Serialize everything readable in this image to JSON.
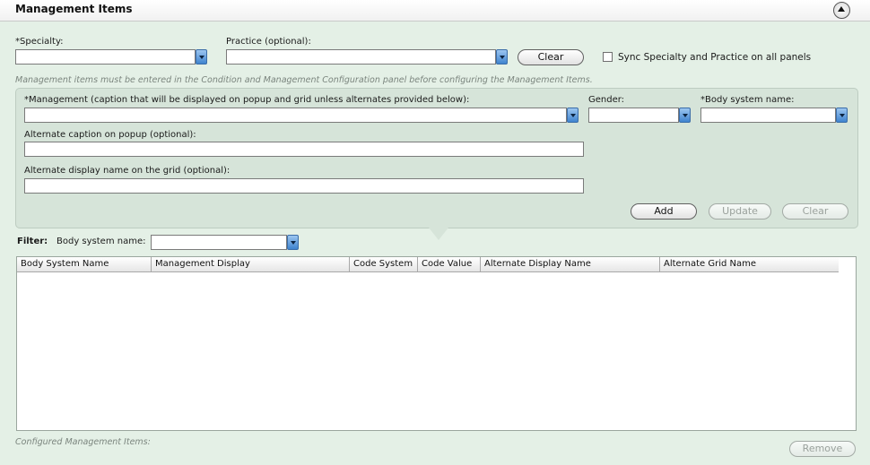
{
  "header": {
    "title": "Management Items"
  },
  "top": {
    "specialty_label": "*Specialty:",
    "practice_label": "Practice (optional):",
    "clear_label": "Clear",
    "sync_label": "Sync Specialty and Practice on all panels",
    "hint": "Management items must be entered in the Condition and Management Configuration panel before configuring the Management Items."
  },
  "form": {
    "management_label": "*Management  (caption that will be displayed on popup and grid unless alternates provided below):",
    "gender_label": "Gender:",
    "body_system_label": "*Body system name:",
    "alt_caption_label": "Alternate caption on popup (optional):",
    "alt_display_label": "Alternate display name on the grid (optional):",
    "add_label": "Add",
    "update_label": "Update",
    "clear_label": "Clear"
  },
  "filter": {
    "title": "Filter:",
    "body_system_label": "Body system name:"
  },
  "grid": {
    "columns": [
      "Body System Name",
      "Management Display",
      "Code System",
      "Code Value",
      "Alternate Display Name",
      "Alternate Grid Name"
    ],
    "rows": []
  },
  "footer": {
    "caption": "Configured Management Items:",
    "remove_label": "Remove"
  },
  "icons": {
    "collapse": "chevron-up-circle-icon",
    "dropdown": "dropdown-arrow-icon"
  },
  "colors": {
    "background": "#e4f0e6",
    "panel": "#d6e4d9",
    "dropdown_accent": "#3f84cf"
  }
}
